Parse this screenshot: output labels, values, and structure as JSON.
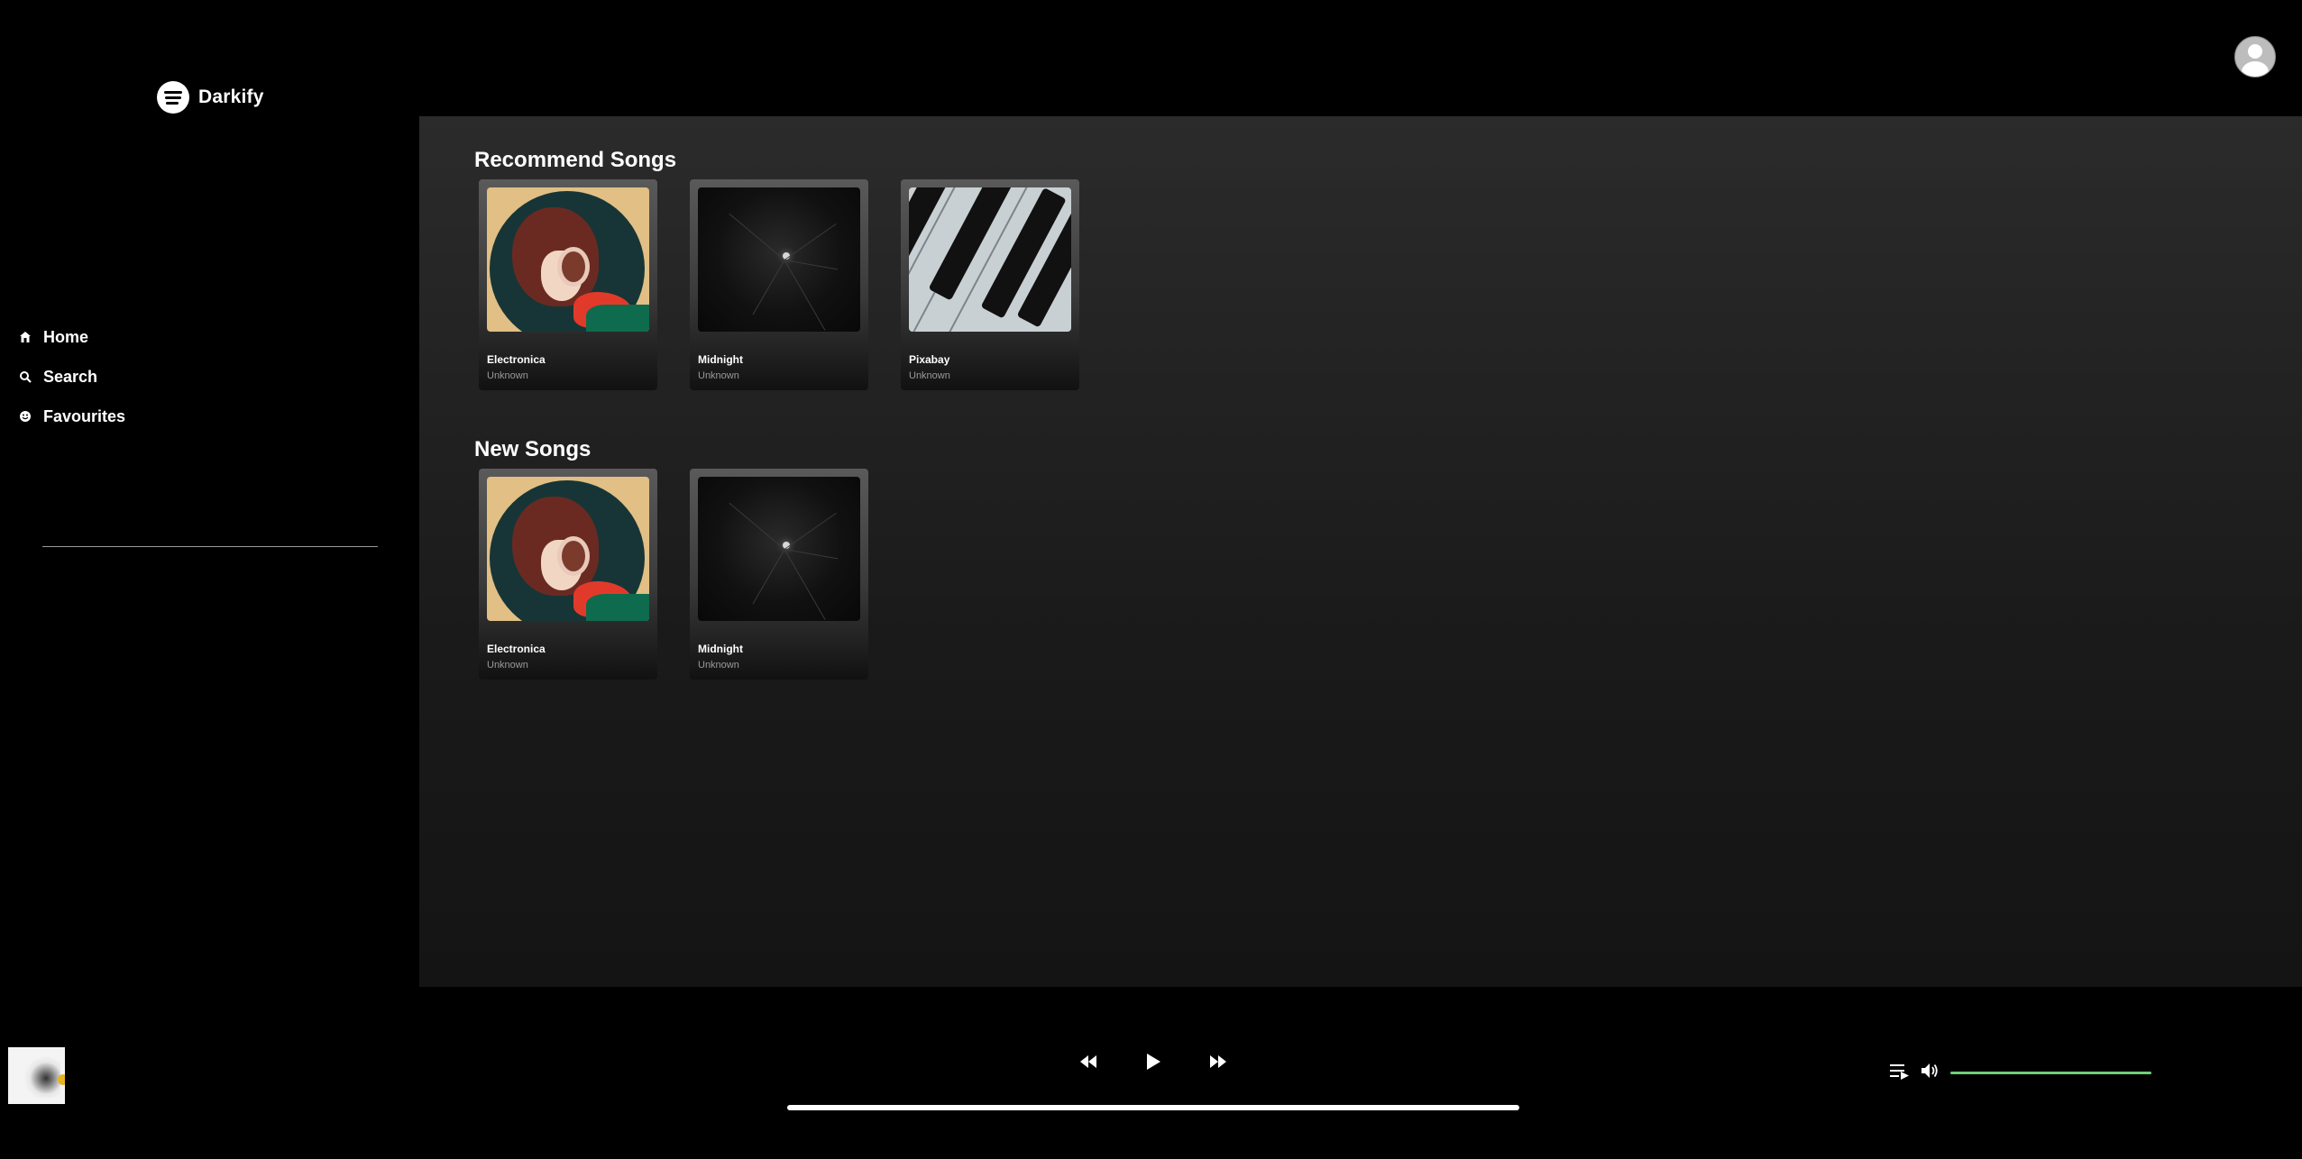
{
  "brand": {
    "name": "Darkify"
  },
  "nav": [
    {
      "label": "Home",
      "icon": "home-icon"
    },
    {
      "label": "Search",
      "icon": "search-icon"
    },
    {
      "label": "Favourites",
      "icon": "smiley-icon"
    }
  ],
  "sections": {
    "recommend": {
      "title": "Recommend Songs",
      "songs": [
        {
          "title": "Electronica",
          "artist": "Unknown"
        },
        {
          "title": "Midnight",
          "artist": "Unknown"
        },
        {
          "title": "Pixabay",
          "artist": "Unknown"
        }
      ]
    },
    "new": {
      "title": "New Songs",
      "songs": [
        {
          "title": "Electronica",
          "artist": "Unknown"
        },
        {
          "title": "Midnight",
          "artist": "Unknown"
        }
      ]
    }
  },
  "player": {
    "controls": [
      "rewind-icon",
      "play-icon",
      "fast-forward-icon"
    ],
    "volume_color": "#6fcf7a"
  },
  "colors": {
    "background": "#000000",
    "accent": "#6fcf7a"
  }
}
